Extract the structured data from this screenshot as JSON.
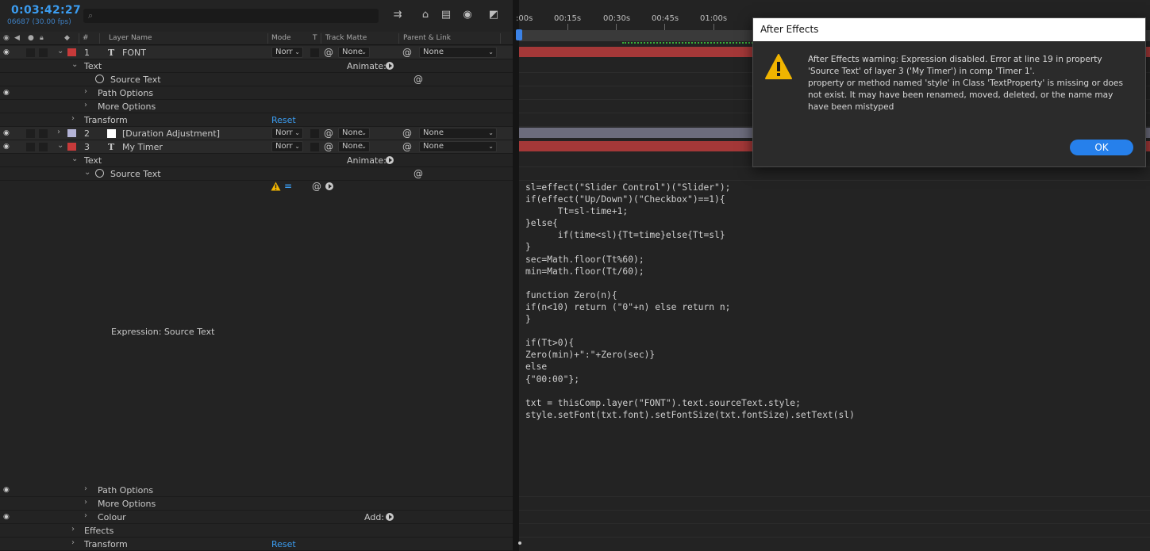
{
  "header": {
    "timecode": "0:03:42:27",
    "frames": "06687 (30.00 fps)",
    "search_icon": "⌕"
  },
  "columns": {
    "hash": "#",
    "layer_name": "Layer Name",
    "mode": "Mode",
    "t": "T",
    "track_matte": "Track Matte",
    "parent_link": "Parent & Link"
  },
  "layers": {
    "l1": {
      "num": "1",
      "name": "FONT",
      "mode": "Norr",
      "matte": "None",
      "parent": "None",
      "color": "#c73a3a"
    },
    "l2": {
      "num": "2",
      "name": "[Duration Adjustment]",
      "mode": "Norr",
      "matte": "None",
      "parent": "None",
      "color": "#b3b3d6"
    },
    "l3": {
      "num": "3",
      "name": "My Timer",
      "mode": "Norr",
      "matte": "None",
      "parent": "None",
      "color": "#c73a3a"
    }
  },
  "props": {
    "text": "Text",
    "animate": "Animate:",
    "source_text": "Source Text",
    "path_options": "Path Options",
    "more_options": "More Options",
    "transform": "Transform",
    "reset": "Reset",
    "colour": "Colour",
    "add": "Add:",
    "effects": "Effects",
    "expression_label": "Expression: Source Text"
  },
  "ruler": {
    "ticks": [
      ":00s",
      "00:15s",
      "00:30s",
      "00:45s",
      "01:00s"
    ]
  },
  "expression_code": "sl=effect(\"Slider Control\")(\"Slider\");\nif(effect(\"Up/Down\")(\"Checkbox\")==1){\n      Tt=sl-time+1;\n}else{\n      if(time<sl){Tt=time}else{Tt=sl}\n}\nsec=Math.floor(Tt%60);\nmin=Math.floor(Tt/60);\n\nfunction Zero(n){\nif(n<10) return (\"0\"+n) else return n;\n}\n\nif(Tt>0){\nZero(min)+\":\"+Zero(sec)}\nelse\n{\"00:00\"};\n\ntxt = thisComp.layer(\"FONT\").text.sourceText.style;\nstyle.setFont(txt.font).setFontSize(txt.fontSize).setText(sl)",
  "dialog": {
    "title": "After Effects",
    "message_line1": "After Effects warning: Expression disabled. Error at line 19 in property 'Source Text' of layer 3 ('My Timer') in comp 'Timer 1'.",
    "message_line2": "property or method named 'style' in Class 'TextProperty' is missing or does not exist. It may have been renamed, moved, deleted, or the name may have been mistyped",
    "ok": "OK"
  },
  "colors": {
    "accent": "#3b9cf0",
    "layer_red": "#a43838",
    "layer_grey": "#6c6c7c",
    "ok_button": "#2680eb",
    "warning": "#f0b400"
  }
}
